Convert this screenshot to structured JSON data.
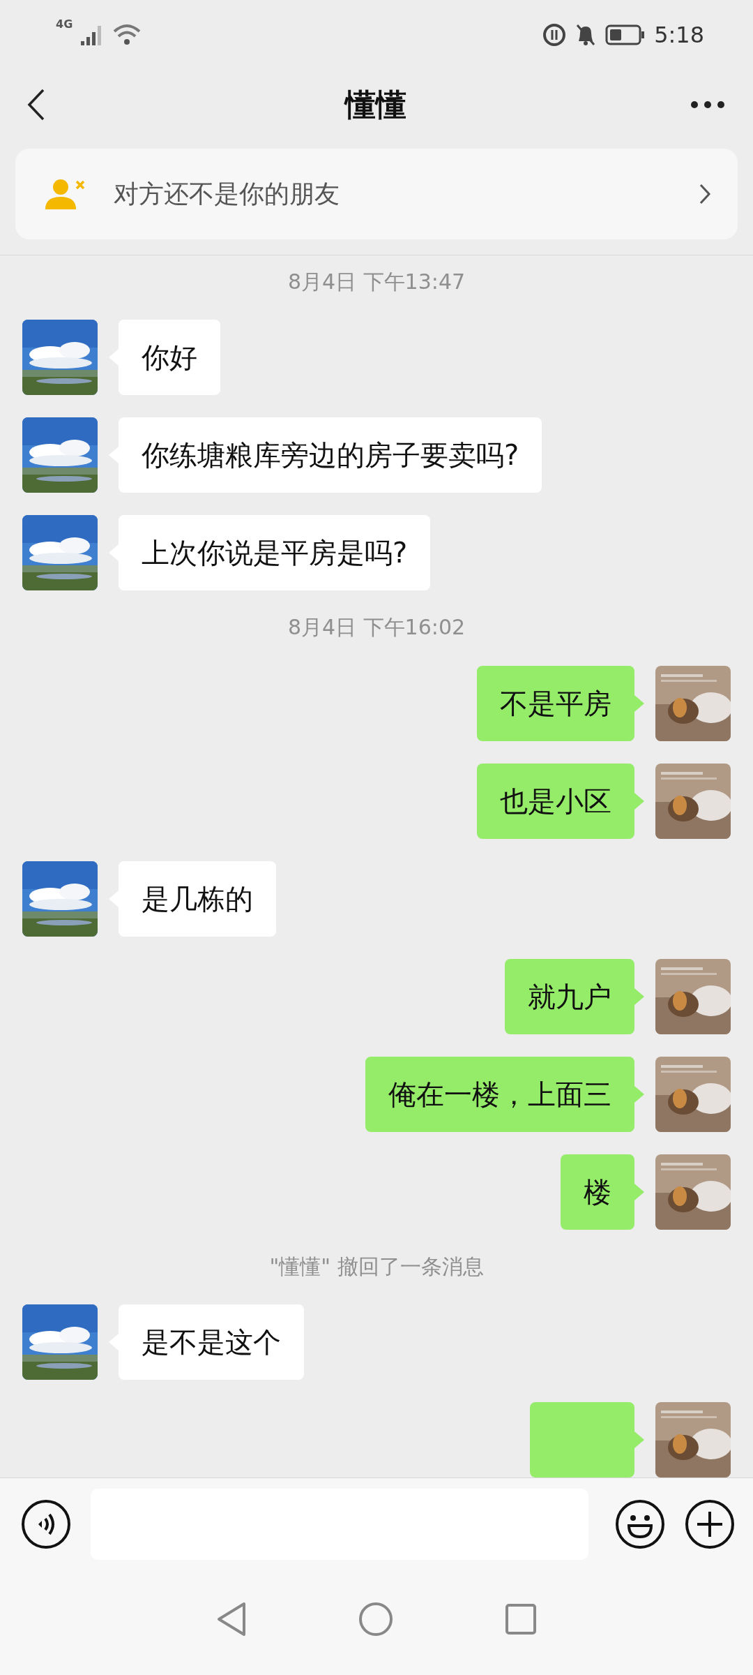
{
  "status_bar": {
    "time": "5:18",
    "network": "4G"
  },
  "header": {
    "title": "懂懂"
  },
  "banner": {
    "text": "对方还不是你的朋友"
  },
  "messages": [
    {
      "kind": "time",
      "text": "8月4日 下午13:47"
    },
    {
      "kind": "message",
      "outgoing": false,
      "text": "你好"
    },
    {
      "kind": "message",
      "outgoing": false,
      "text": "你练塘粮库旁边的房子要卖吗?"
    },
    {
      "kind": "message",
      "outgoing": false,
      "text": "上次你说是平房是吗?"
    },
    {
      "kind": "time",
      "text": "8月4日 下午16:02"
    },
    {
      "kind": "message",
      "outgoing": true,
      "text": "不是平房"
    },
    {
      "kind": "message",
      "outgoing": true,
      "text": "也是小区"
    },
    {
      "kind": "message",
      "outgoing": false,
      "text": "是几栋的"
    },
    {
      "kind": "message",
      "outgoing": true,
      "text": "就九户"
    },
    {
      "kind": "message",
      "outgoing": true,
      "text": "俺在一楼，上面三"
    },
    {
      "kind": "message",
      "outgoing": true,
      "text": "楼"
    },
    {
      "kind": "notice",
      "text": "\"懂懂\" 撤回了一条消息"
    },
    {
      "kind": "message",
      "outgoing": false,
      "text": "是不是这个"
    },
    {
      "kind": "message",
      "outgoing": true
    }
  ]
}
